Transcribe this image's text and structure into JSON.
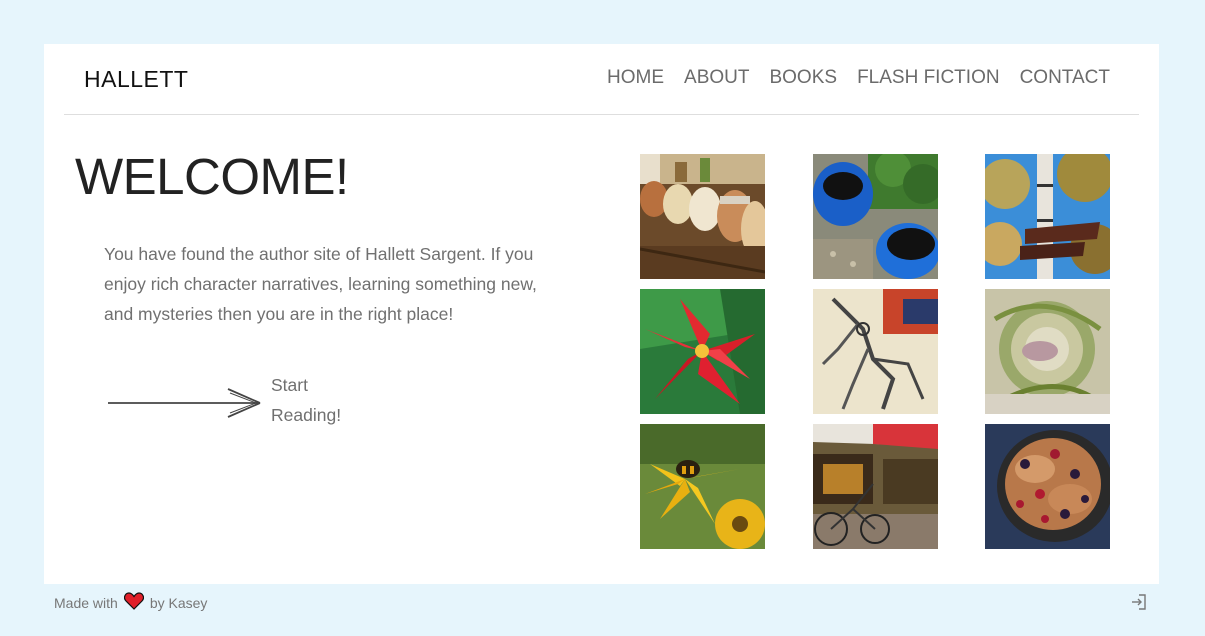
{
  "site": {
    "logo": "HALLETT"
  },
  "nav": {
    "items": [
      {
        "label": "HOME"
      },
      {
        "label": "ABOUT"
      },
      {
        "label": "BOOKS"
      },
      {
        "label": "FLASH FICTION"
      },
      {
        "label": "CONTACT"
      }
    ]
  },
  "main": {
    "heading": "WELCOME!",
    "intro": "You have found the author site of Hallett Sargent. If you enjoy rich character narratives, learning something new, and mysteries then you are in the right place!",
    "cta_label": "Start Reading!"
  },
  "gallery": {
    "images": [
      {
        "subject": "jars-on-shelf"
      },
      {
        "subject": "blue-pots"
      },
      {
        "subject": "birch-tree-signpost"
      },
      {
        "subject": "red-bromeliad-flower"
      },
      {
        "subject": "wire-sculpture"
      },
      {
        "subject": "curled-leaves"
      },
      {
        "subject": "bee-on-yellow-flower"
      },
      {
        "subject": "bicycles-market"
      },
      {
        "subject": "berry-pastry"
      }
    ]
  },
  "footer": {
    "made_with": "Made with",
    "by": "by Kasey",
    "heart_color": "#e0202a"
  },
  "colors": {
    "page_bg": "#e6f5fc",
    "card_bg": "#ffffff",
    "nav_text": "#6b6b6b",
    "body_text": "#707070"
  }
}
